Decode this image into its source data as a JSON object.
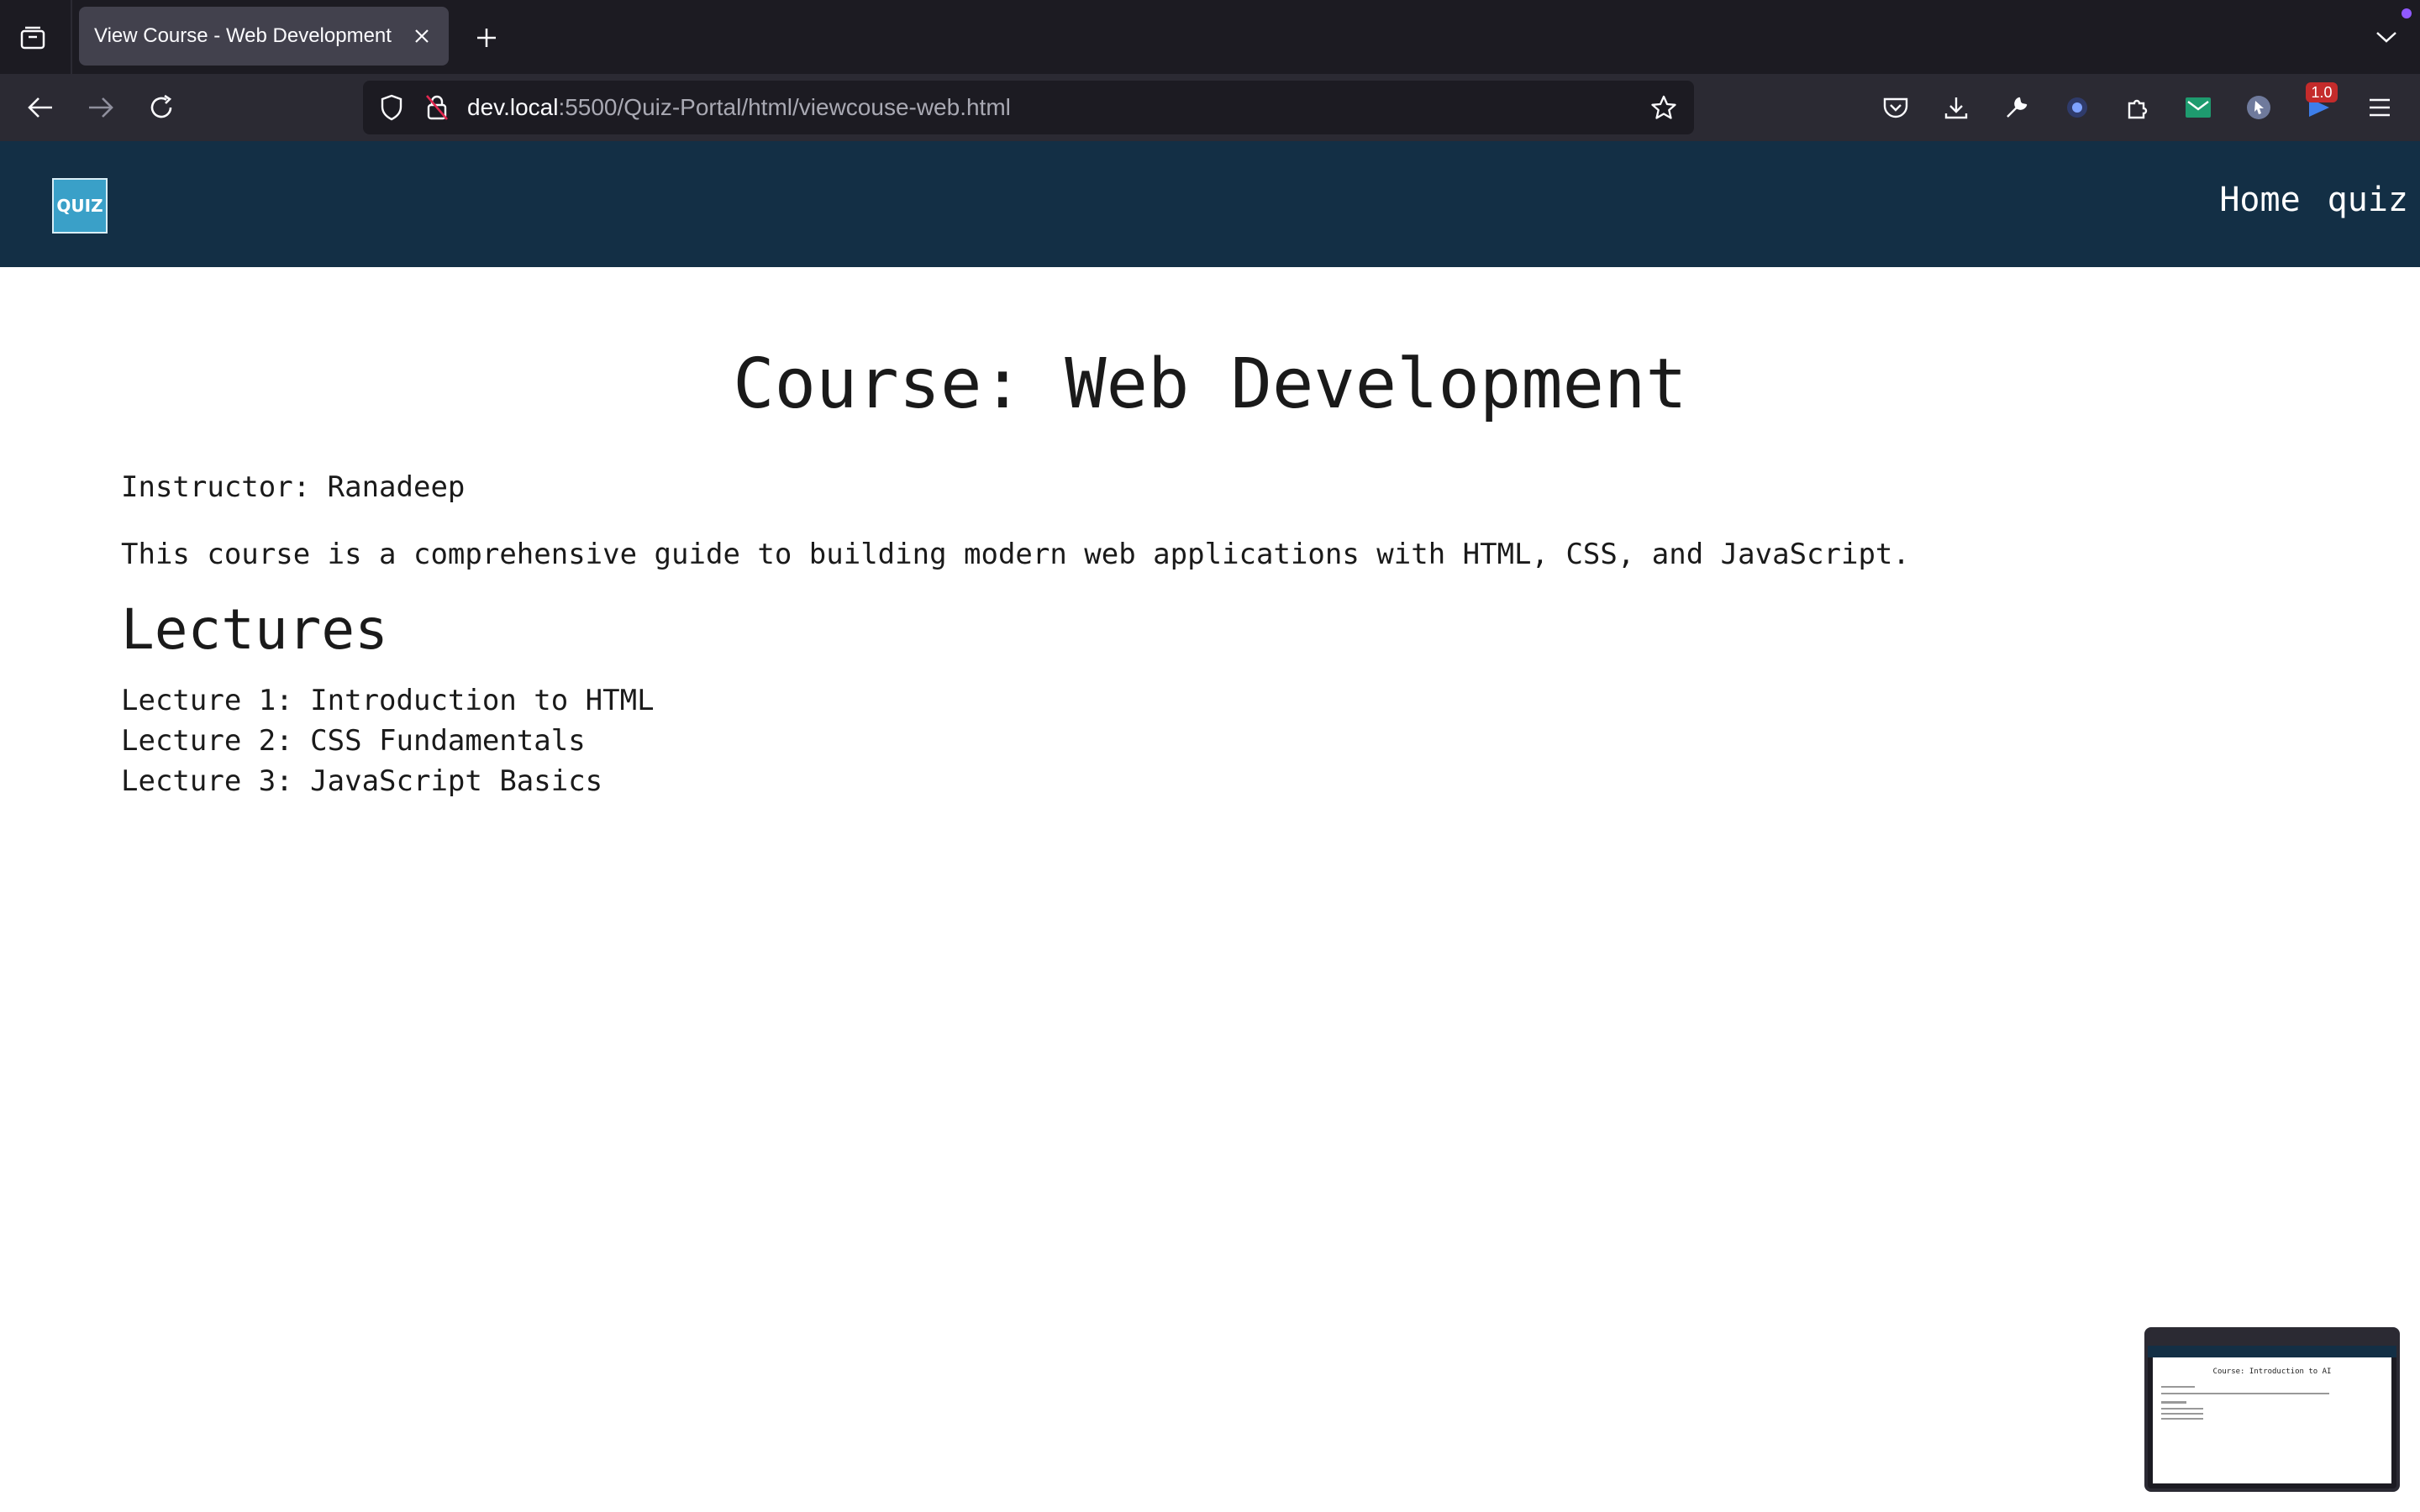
{
  "browser": {
    "tab_title": "View Course - Web Development",
    "url_host": "dev.local",
    "url_rest": ":5500/Quiz-Portal/html/viewcouse-web.html",
    "extension_badge": "1.0",
    "icons": [
      "tab-list-icon",
      "close-icon",
      "plus-icon",
      "chevron-down-icon",
      "back-arrow-icon",
      "forward-arrow-icon",
      "reload-icon",
      "shield-icon",
      "lock-icon",
      "star-icon",
      "pocket-icon",
      "download-icon",
      "wrench-icon",
      "extension-dark-icon",
      "puzzle-icon",
      "mail-extension-icon",
      "cursor-extension-icon",
      "flag-extension-icon",
      "hamburger-menu-icon"
    ]
  },
  "site": {
    "logo_text": "QUIZ",
    "nav": [
      "Home",
      "quiz"
    ]
  },
  "course": {
    "title": "Course: Web Development",
    "instructor": "Instructor: Ranadeep",
    "description": "This course is a comprehensive guide to building modern web applications with HTML, CSS, and JavaScript.",
    "lectures_heading": "Lectures",
    "lectures": [
      "Lecture 1: Introduction to HTML",
      "Lecture 2: CSS Fundamentals",
      "Lecture 3: JavaScript Basics"
    ]
  },
  "pip": {
    "title": "Course: Introduction to AI"
  },
  "colors": {
    "header_bg": "#132f45",
    "chrome_dark": "#1c1b22",
    "chrome_mid": "#2b2a33",
    "tab_active": "#42414d"
  }
}
